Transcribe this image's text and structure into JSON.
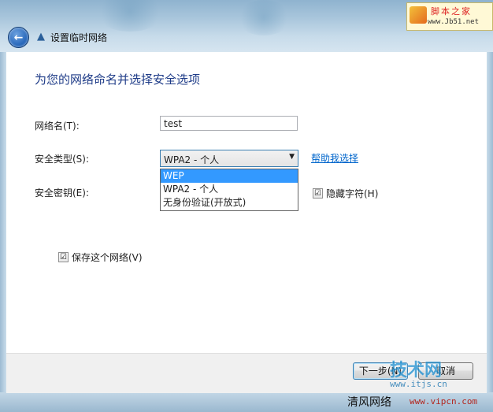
{
  "window": {
    "title": "设置临时网络",
    "back_icon": "back-arrow-icon",
    "network_icon": "adhoc-network-icon"
  },
  "main": {
    "heading": "为您的网络命名并选择安全选项",
    "network_name_label": "网络名(T):",
    "network_name_value": "test",
    "security_type_label": "安全类型(S):",
    "security_type_selected": "WPA2 - 个人",
    "security_type_options": [
      "WEP",
      "WPA2 - 个人",
      "无身份验证(开放式)"
    ],
    "security_type_highlighted": "WEP",
    "help_link": "帮助我选择",
    "security_key_label": "安全密钥(E):",
    "hide_chars_label": "隐藏字符(H)",
    "hide_chars_checked": true,
    "save_network_label": "保存这个网络(V)",
    "save_network_checked": true,
    "check_mark": "☑"
  },
  "footer": {
    "next_label": "下一步(N)",
    "cancel_label": "取消"
  },
  "watermarks": {
    "top_line1": "脚本之家",
    "top_line2": "www.Jb51.net",
    "tech_brand": "技术网",
    "tech_url": "www.itjs.cn",
    "bottom_left": "清风网络",
    "bottom_right": "www.vipcn.com"
  },
  "colors": {
    "heading": "#1f3c88",
    "link": "#0066cc",
    "selection": "#3399ff"
  }
}
